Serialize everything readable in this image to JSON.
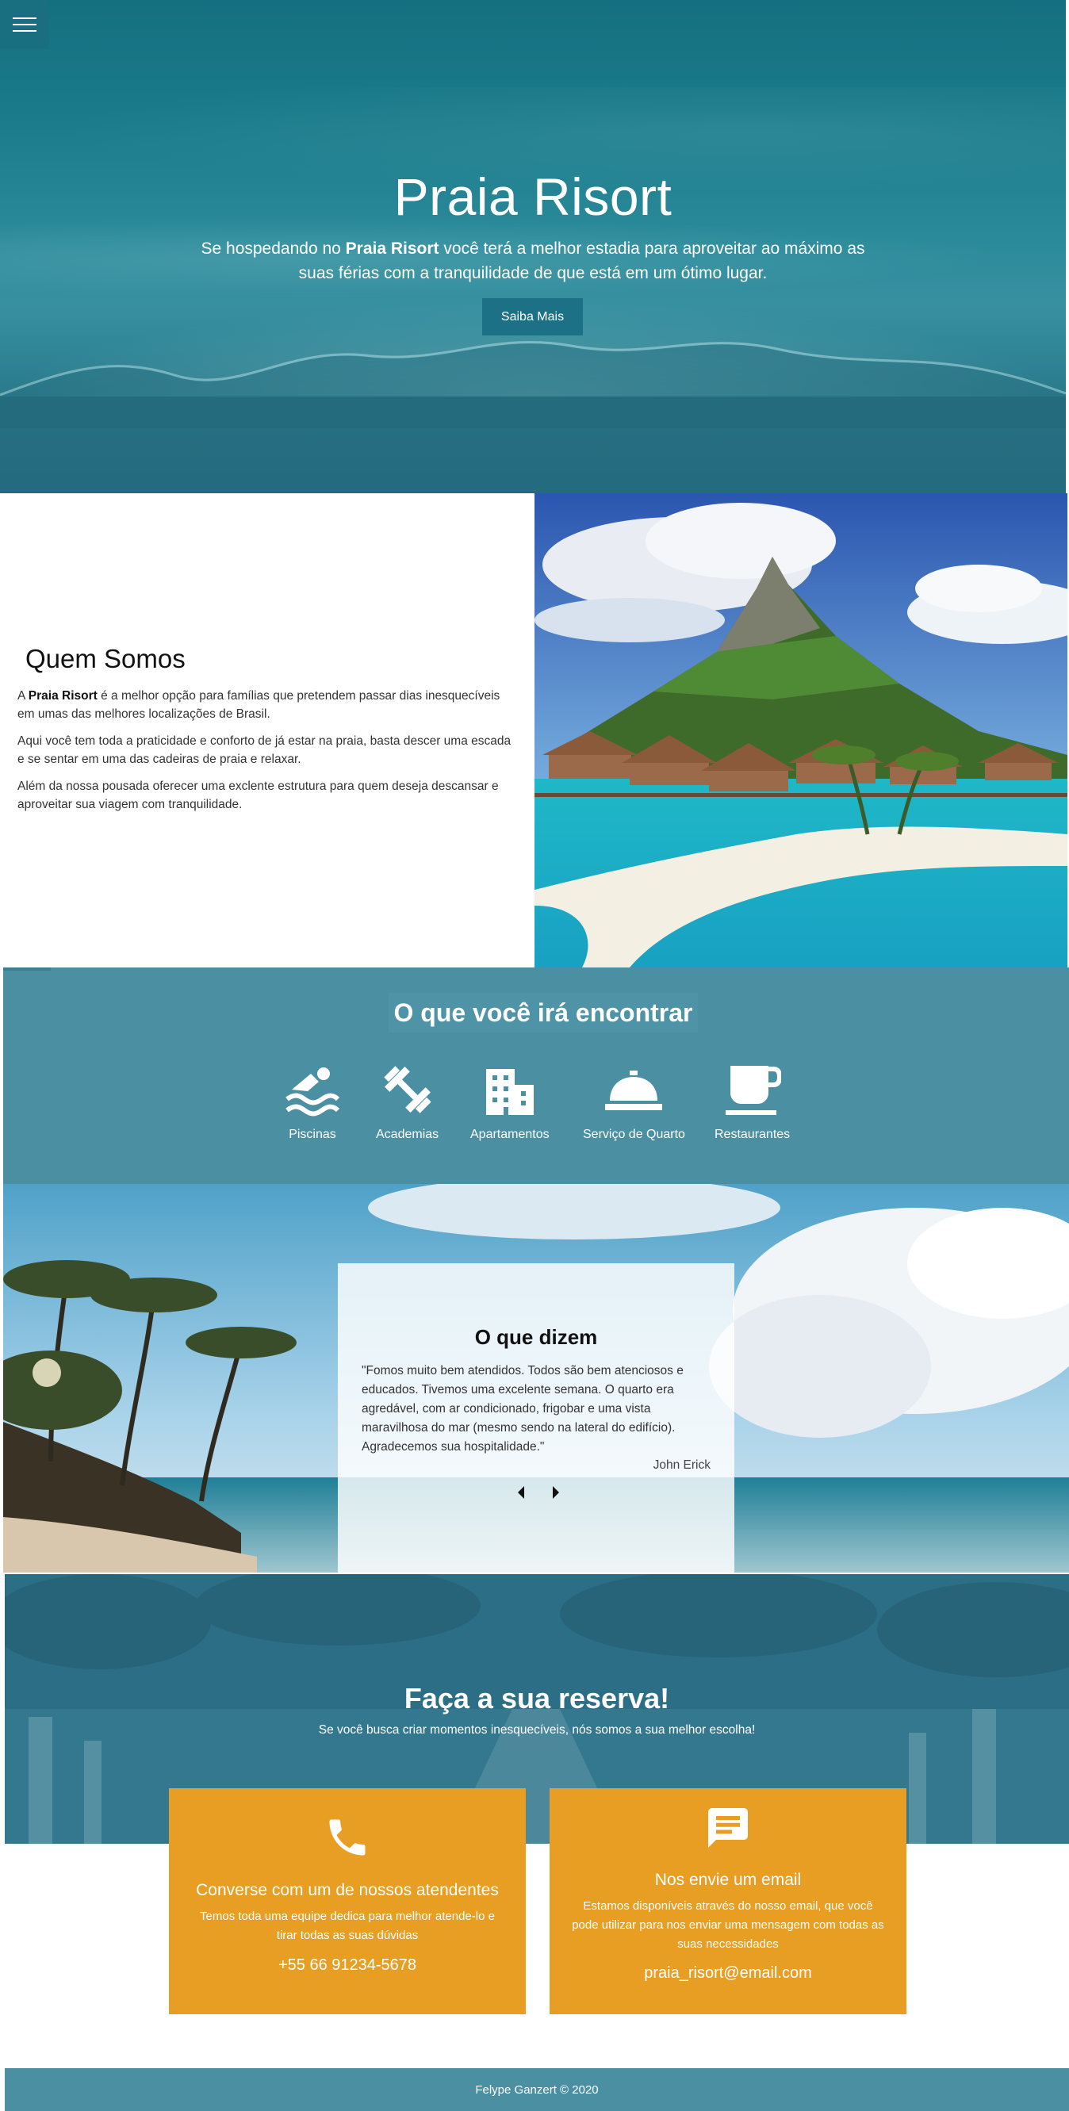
{
  "hero": {
    "title": "Praia Risort",
    "subtitle_pre": "Se hospedando no ",
    "subtitle_brand": "Praia Risort",
    "subtitle_post": " você terá a melhor estadia para aproveitar ao máximo as suas férias com a tranquilidade de que está em um ótimo lugar.",
    "button_label": "Saiba Mais",
    "menu_icon": "hamburger-menu-icon"
  },
  "about": {
    "title": "Quem Somos",
    "p1_pre": "A ",
    "p1_brand": "Praia Risort",
    "p1_post": " é a melhor opção para famílias que pretendem passar dias inesquecíveis em umas das melhores localizações de Brasil.",
    "p2": "Aqui você tem toda a praticidade e conforto de já estar na praia, basta descer uma escada e se sentar em uma das cadeiras de praia e relaxar.",
    "p3": "Além da nossa pousada oferecer uma exclente estrutura para quem deseja descansar e aproveitar sua viagem com tranquilidade."
  },
  "services": {
    "title": "O que você irá encontrar",
    "items": [
      {
        "label": "Piscinas",
        "icon": "swimmer-icon"
      },
      {
        "label": "Academias",
        "icon": "dumbbell-icon"
      },
      {
        "label": "Apartamentos",
        "icon": "building-icon"
      },
      {
        "label": "Serviço de Quarto",
        "icon": "room-service-icon"
      },
      {
        "label": "Restaurantes",
        "icon": "coffee-cup-icon"
      }
    ]
  },
  "testimonial": {
    "title": "O que dizem",
    "text": "\"Fomos muito bem atendidos. Todos são bem atenciosos e educados. Tivemos uma excelente semana. O quarto era agredável, com ar condicionado, frigobar e uma vista maravilhosa do mar (mesmo sendo na lateral do edifício). Agradecemos sua hospitalidade.\"",
    "author": "John Erick"
  },
  "reserva": {
    "title": "Faça a sua reserva!",
    "subtitle": "Se você busca criar momentos inesquecíveis, nós somos a sua melhor escolha!",
    "phone_card": {
      "icon": "phone-icon",
      "title": "Converse com um de nossos atendentes",
      "text": "Temos toda uma equipe dedica para melhor atende-lo e tirar todas as suas dúvidas",
      "contact": "+55 66 91234-5678"
    },
    "email_card": {
      "icon": "message-icon",
      "title": "Nos envie um email",
      "text": "Estamos disponíveis através do nosso email, que você pode utilizar para nos enviar uma mensagem com todas as suas necessidades",
      "contact": "praia_risort@email.com"
    }
  },
  "footer": {
    "text": "Felype Ganzert © 2020"
  },
  "colors": {
    "accent": "#4b8fa3",
    "button": "#1d7187",
    "card": "#e89e22"
  }
}
